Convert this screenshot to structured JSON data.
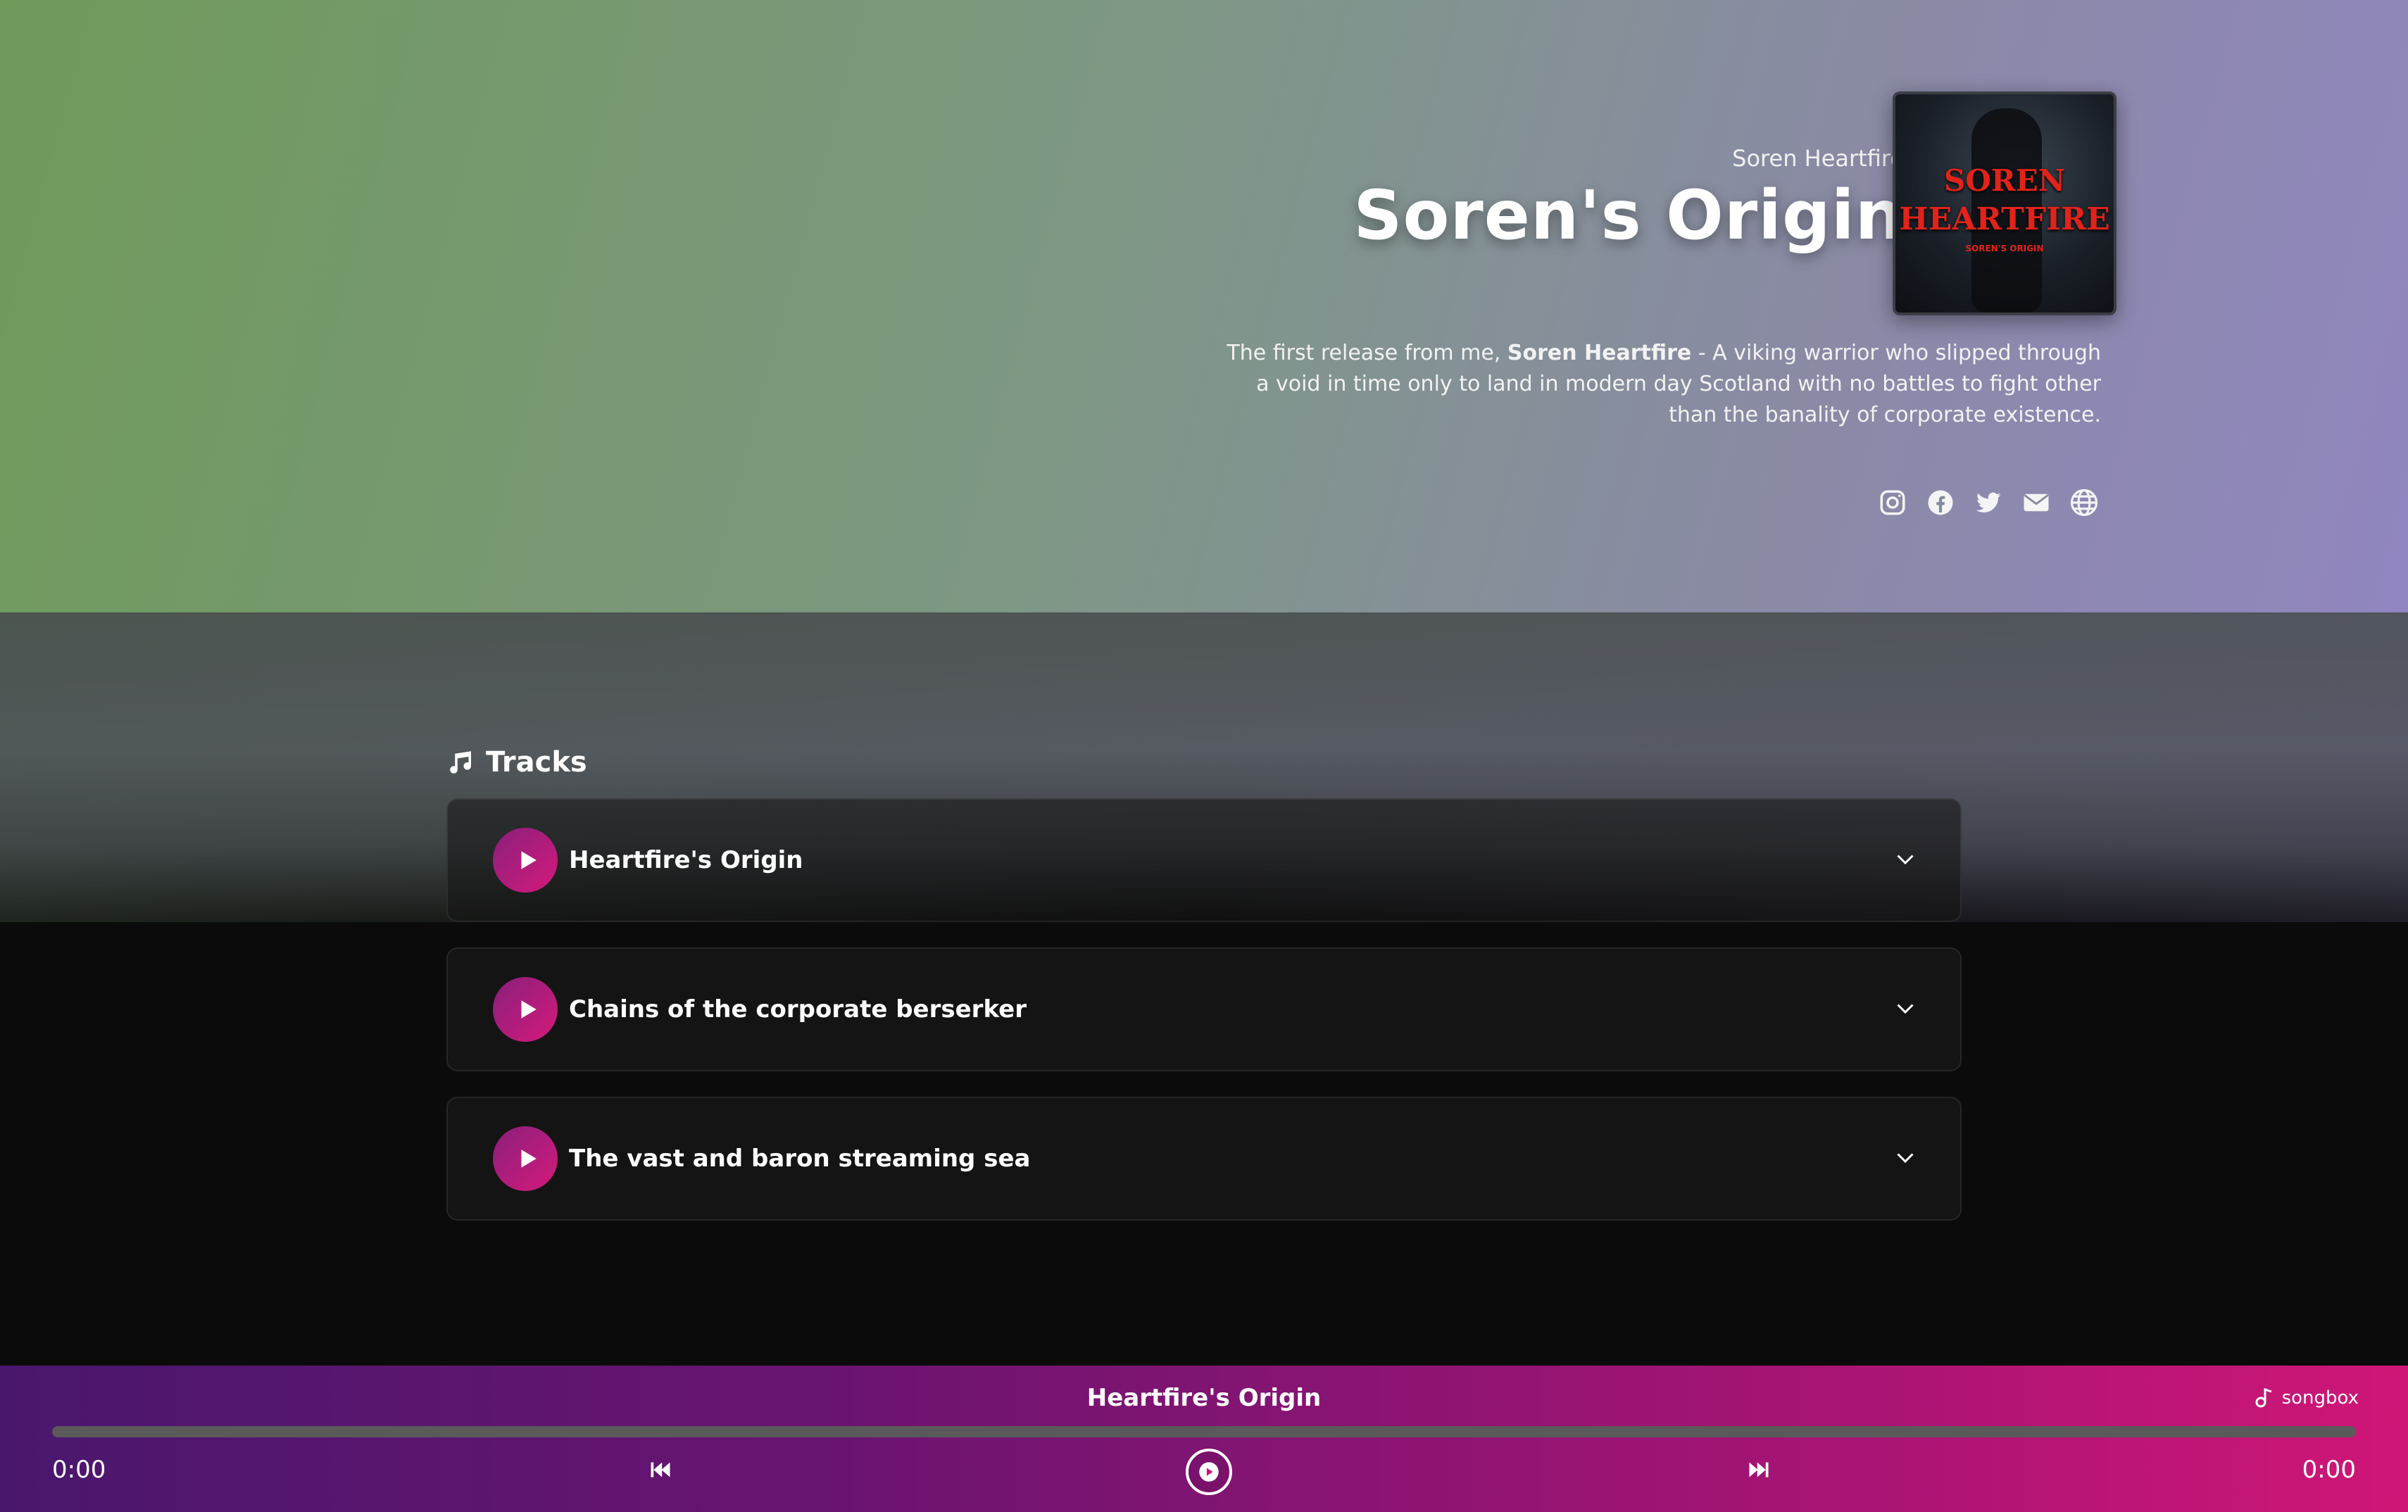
{
  "album": {
    "artist": "Soren Heartfire",
    "title": "Soren's Origin",
    "cover_text": {
      "line1": "SOREN",
      "line2": "HEARTFIRE",
      "line3": "SOREN'S ORIGIN"
    },
    "description": {
      "prefix": "The first release from me, ",
      "bold": "Soren Heartfire",
      "suffix": " - A viking warrior who slipped through a void in time only to land in modern day Scotland with no battles to fight other than the banality of corporate existence."
    },
    "social_icons": [
      "instagram-icon",
      "facebook-icon",
      "twitter-icon",
      "email-icon",
      "globe-icon"
    ]
  },
  "tracks": {
    "heading": "Tracks",
    "items": [
      {
        "name": "Heartfire's Origin"
      },
      {
        "name": "Chains of the corporate berserker"
      },
      {
        "name": "The vast and baron streaming sea"
      }
    ]
  },
  "player": {
    "now_playing": "Heartfire's Origin",
    "current_time": "0:00",
    "duration": "0:00",
    "progress": 0,
    "brand": "songbox"
  },
  "colors": {
    "accent_start": "#8a1f7d",
    "accent_end": "#d41a7a",
    "player_start": "#4a176e",
    "player_end": "#cf1677"
  }
}
